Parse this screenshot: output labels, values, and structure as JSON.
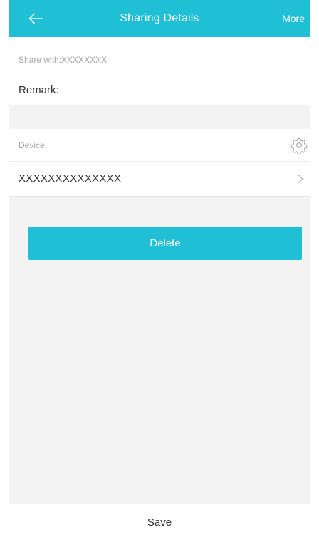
{
  "header": {
    "title": "Sharing Details",
    "back_icon": "arrow-left-icon",
    "more_label": "More"
  },
  "share_with": {
    "label": "Share with:",
    "value": "XXXXXXXX"
  },
  "remark": {
    "label": "Remark:"
  },
  "device_section": {
    "label": "Device",
    "settings_icon": "gear-icon",
    "device_name": "XXXXXXXXXXXXXX",
    "chevron_icon": "chevron-right-icon"
  },
  "actions": {
    "delete_label": "Delete",
    "save_label": "Save"
  },
  "colors": {
    "accent": "#1fc0d6",
    "background": "#f3f3f3",
    "muted_text": "#a6a6a6",
    "primary_text": "#333333"
  }
}
